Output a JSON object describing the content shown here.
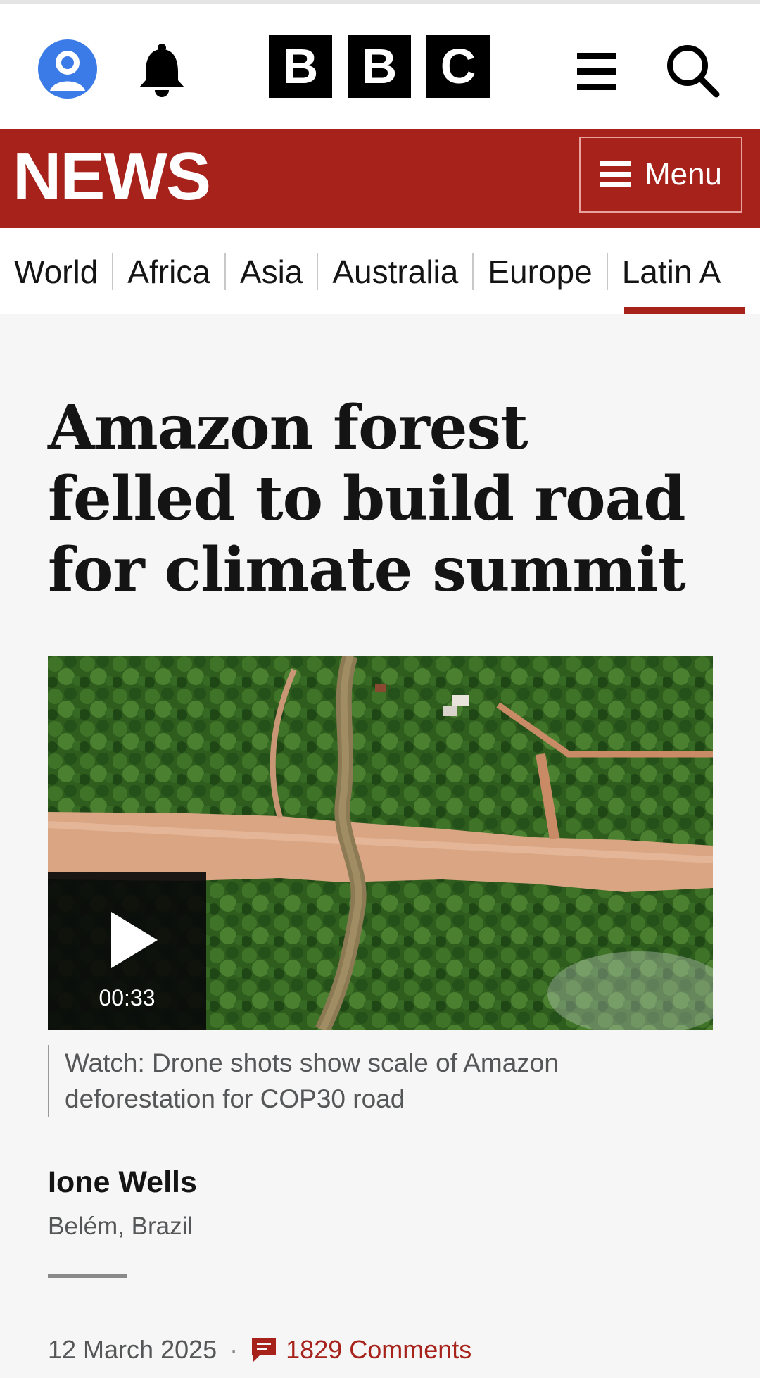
{
  "masthead": {
    "logo_letters": [
      "B",
      "B",
      "C"
    ],
    "icons": [
      "account-icon",
      "notification-bell-icon",
      "hamburger-menu-icon",
      "search-icon"
    ]
  },
  "newsbar": {
    "title": "NEWS",
    "menu_label": "Menu",
    "background_color": "#a6221a"
  },
  "nav": {
    "items": [
      "World",
      "Africa",
      "Asia",
      "Australia",
      "Europe",
      "Latin A"
    ],
    "active_index": 5,
    "accent_color": "#a6221a"
  },
  "article": {
    "headline": "Amazon forest felled to build road for climate summit",
    "video": {
      "duration": "00:33",
      "caption": "Watch: Drone shots show scale of Amazon deforestation for COP30 road"
    },
    "author": {
      "name": "Ione Wells",
      "location": "Belém, Brazil"
    },
    "date": "12 March 2025",
    "separator": "·",
    "comments_label": "1829 Comments"
  }
}
